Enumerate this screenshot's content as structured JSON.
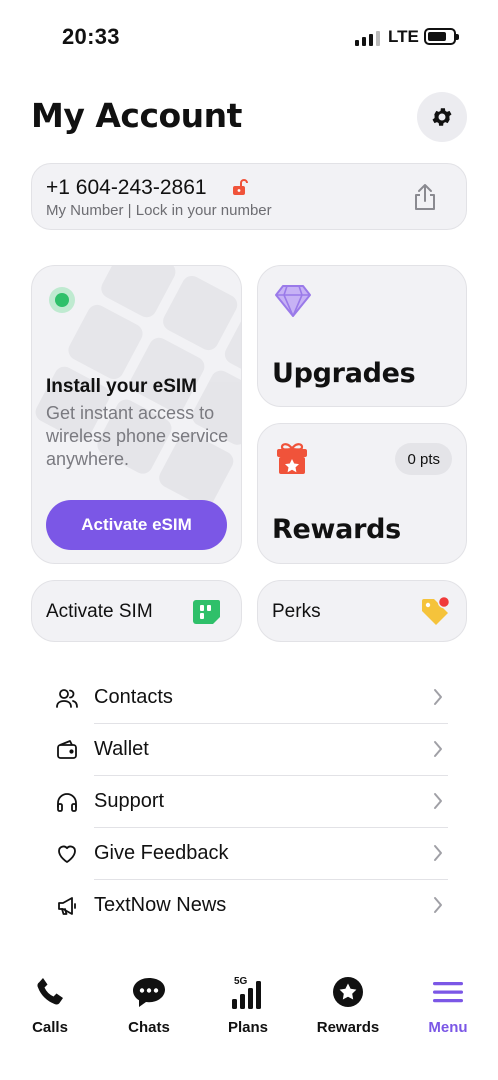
{
  "status_bar": {
    "time": "20:33",
    "network": "LTE"
  },
  "header": {
    "title": "My Account"
  },
  "number_card": {
    "number": "+1 604-243-2861",
    "subtitle": "My Number | Lock in your number"
  },
  "esim_card": {
    "title": "Install your eSIM",
    "description": "Get instant access to wireless phone service anywhere.",
    "button_label": "Activate eSIM"
  },
  "upgrades_card": {
    "label": "Upgrades"
  },
  "rewards_card": {
    "label": "Rewards",
    "points": "0 pts"
  },
  "activate_sim": {
    "label": "Activate SIM"
  },
  "perks": {
    "label": "Perks"
  },
  "menu": {
    "items": [
      {
        "label": "Contacts",
        "icon": "contacts-icon"
      },
      {
        "label": "Wallet",
        "icon": "wallet-icon"
      },
      {
        "label": "Support",
        "icon": "headphones-icon"
      },
      {
        "label": "Give Feedback",
        "icon": "heart-icon"
      },
      {
        "label": "TextNow News",
        "icon": "megaphone-icon"
      }
    ]
  },
  "tabbar": {
    "tabs": [
      {
        "label": "Calls",
        "icon": "phone-icon"
      },
      {
        "label": "Chats",
        "icon": "chat-icon"
      },
      {
        "label": "Plans",
        "icon": "signal-5g-icon",
        "badge": "5G"
      },
      {
        "label": "Rewards",
        "icon": "star-badge-icon"
      },
      {
        "label": "Menu",
        "icon": "hamburger-icon"
      }
    ],
    "active": "Menu"
  },
  "colors": {
    "accent": "#7b57e6",
    "esim_green": "#2fc06a",
    "lock_red": "#f0533a",
    "perks_yellow": "#f5c33b"
  }
}
